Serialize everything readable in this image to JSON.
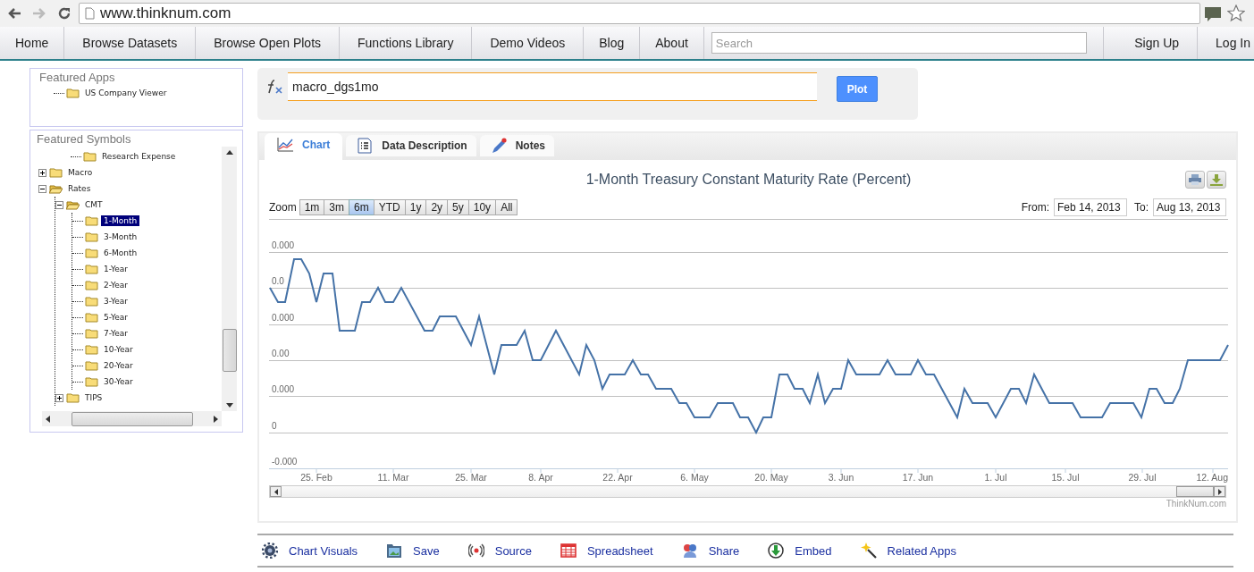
{
  "browser": {
    "back_enabled": true,
    "forward_enabled": false,
    "url": "www.thinknum.com"
  },
  "nav": {
    "items": [
      {
        "label": "Home"
      },
      {
        "label": "Browse Datasets"
      },
      {
        "label": "Browse Open Plots"
      },
      {
        "label": "Functions Library"
      },
      {
        "label": "Demo Videos"
      },
      {
        "label": "Blog"
      },
      {
        "label": "About"
      }
    ],
    "search": {
      "placeholder": "Search"
    },
    "account": [
      {
        "label": "Sign Up"
      },
      {
        "label": "Log In"
      }
    ]
  },
  "featured_apps": {
    "title": "Featured Apps",
    "items": [
      {
        "label": "US Company Viewer",
        "selected": false
      }
    ]
  },
  "featured_symbols": {
    "title": "Featured Symbols",
    "continued_items": [
      {
        "label": "Research Expense",
        "selected": false
      }
    ],
    "tree": [
      {
        "label": "Macro",
        "expanded": false,
        "selected": false
      },
      {
        "label": "Rates",
        "expanded": true,
        "selected": false,
        "children": [
          {
            "label": "CMT",
            "expanded": true,
            "selected": false,
            "children": [
              {
                "label": "1-Month",
                "selected": true
              },
              {
                "label": "3-Month",
                "selected": false
              },
              {
                "label": "6-Month",
                "selected": false
              },
              {
                "label": "1-Year",
                "selected": false
              },
              {
                "label": "2-Year",
                "selected": false
              },
              {
                "label": "3-Year",
                "selected": false
              },
              {
                "label": "5-Year",
                "selected": false
              },
              {
                "label": "7-Year",
                "selected": false
              },
              {
                "label": "10-Year",
                "selected": false
              },
              {
                "label": "20-Year",
                "selected": false
              },
              {
                "label": "30-Year",
                "selected": false
              }
            ]
          },
          {
            "label": "TIPS",
            "expanded": false,
            "selected": false
          }
        ]
      }
    ]
  },
  "formula": {
    "value": "macro_dgs1mo",
    "button": "Plot"
  },
  "tabs": [
    {
      "label": "Chart",
      "selected": true,
      "kind": "chart"
    },
    {
      "label": "Data Description",
      "selected": false,
      "kind": "list"
    },
    {
      "label": "Notes",
      "selected": false,
      "kind": "pencil"
    }
  ],
  "chart": {
    "title": "1-Month Treasury Constant Maturity Rate (Percent)",
    "zoom_label": "Zoom",
    "zoom": [
      {
        "label": "1m",
        "selected": false
      },
      {
        "label": "3m",
        "selected": false
      },
      {
        "label": "6m",
        "selected": true
      },
      {
        "label": "YTD",
        "selected": false
      },
      {
        "label": "1y",
        "selected": false
      },
      {
        "label": "2y",
        "selected": false
      },
      {
        "label": "5y",
        "selected": false
      },
      {
        "label": "10y",
        "selected": false
      },
      {
        "label": "All",
        "selected": false
      }
    ],
    "from_label": "From:",
    "from": "Feb 14, 2013",
    "to_label": "To:",
    "to": "Aug 13, 2013",
    "y_labels": [
      "0.000",
      "0.0",
      "0.000",
      "0.00",
      "0.000",
      "0",
      "-0.000"
    ],
    "x_labels": [
      "25. Feb",
      "11. Mar",
      "25. Mar",
      "8. Apr",
      "22. Apr",
      "6. May",
      "20. May",
      "3. Jun",
      "17. Jun",
      "1. Jul",
      "15. Jul",
      "29. Jul",
      "12. Aug"
    ],
    "credit": "ThinkNum.com"
  },
  "toolbar": [
    {
      "label": "Chart Visuals",
      "kind": "gear"
    },
    {
      "label": "Save",
      "kind": "save"
    },
    {
      "label": "Source",
      "kind": "source"
    },
    {
      "label": "Spreadsheet",
      "kind": "sheet"
    },
    {
      "label": "Share",
      "kind": "share"
    },
    {
      "label": "Embed",
      "kind": "embed"
    },
    {
      "label": "Related Apps",
      "kind": "wand"
    }
  ]
}
